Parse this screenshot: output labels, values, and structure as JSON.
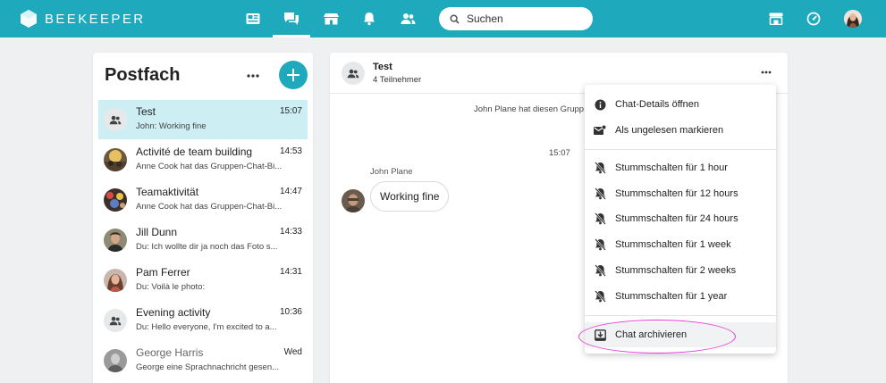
{
  "app": {
    "brand": "BEEKEEPER"
  },
  "search": {
    "placeholder": "Suchen"
  },
  "colors": {
    "brand": "#1ea9bd",
    "selected_row": "#cdeef3",
    "annotation": "#e83ad8"
  },
  "nav": {
    "items": [
      {
        "name": "news-feed-icon"
      },
      {
        "name": "chat-icon",
        "active": true
      },
      {
        "name": "store-icon"
      },
      {
        "name": "notifications-icon"
      },
      {
        "name": "contacts-icon"
      }
    ],
    "right": [
      {
        "name": "apps-icon"
      },
      {
        "name": "dashboard-icon"
      },
      {
        "name": "user-avatar"
      }
    ]
  },
  "inbox": {
    "title": "Postfach",
    "chats": [
      {
        "name": "Test",
        "time": "15:07",
        "preview": "John: Working fine",
        "avatar": "group",
        "selected": true
      },
      {
        "name": "Activité de team building",
        "time": "14:53",
        "preview": "Anne Cook hat das Gruppen-Chat-Bi...",
        "avatar": "photo"
      },
      {
        "name": "Teamaktivität",
        "time": "14:47",
        "preview": "Anne Cook hat das Gruppen-Chat-Bi...",
        "avatar": "photo"
      },
      {
        "name": "Jill Dunn",
        "time": "14:33",
        "preview": "Du: Ich wollte dir ja noch das Foto s...",
        "avatar": "photo"
      },
      {
        "name": "Pam Ferrer",
        "time": "14:31",
        "preview": "Du: Voilà le photo:",
        "avatar": "photo"
      },
      {
        "name": "Evening activity",
        "time": "10:36",
        "preview": "Du: Hello everyone, I'm excited to a...",
        "avatar": "group"
      },
      {
        "name": "George Harris",
        "time": "Wed",
        "preview": "George eine Sprachnachricht gesen...",
        "avatar": "photo"
      }
    ]
  },
  "conversation": {
    "title": "Test",
    "subtitle": "4 Teilnehmer",
    "system_message": "John Plane hat diesen Grupp",
    "timestamp": "15:07",
    "sender": "John Plane",
    "message": "Working fine"
  },
  "menu": {
    "items": [
      {
        "label": "Chat-Details öffnen",
        "icon": "info-icon"
      },
      {
        "label": "Als ungelesen markieren",
        "icon": "mark-unread-icon"
      },
      {
        "label": "Stummschalten für 1 hour",
        "icon": "mute-icon"
      },
      {
        "label": "Stummschalten für 12 hours",
        "icon": "mute-icon"
      },
      {
        "label": "Stummschalten für 24 hours",
        "icon": "mute-icon"
      },
      {
        "label": "Stummschalten für 1 week",
        "icon": "mute-icon"
      },
      {
        "label": "Stummschalten für 2 weeks",
        "icon": "mute-icon"
      },
      {
        "label": "Stummschalten für 1 year",
        "icon": "mute-icon"
      },
      {
        "label": "Chat archivieren",
        "icon": "archive-icon",
        "highlighted": true
      }
    ]
  }
}
